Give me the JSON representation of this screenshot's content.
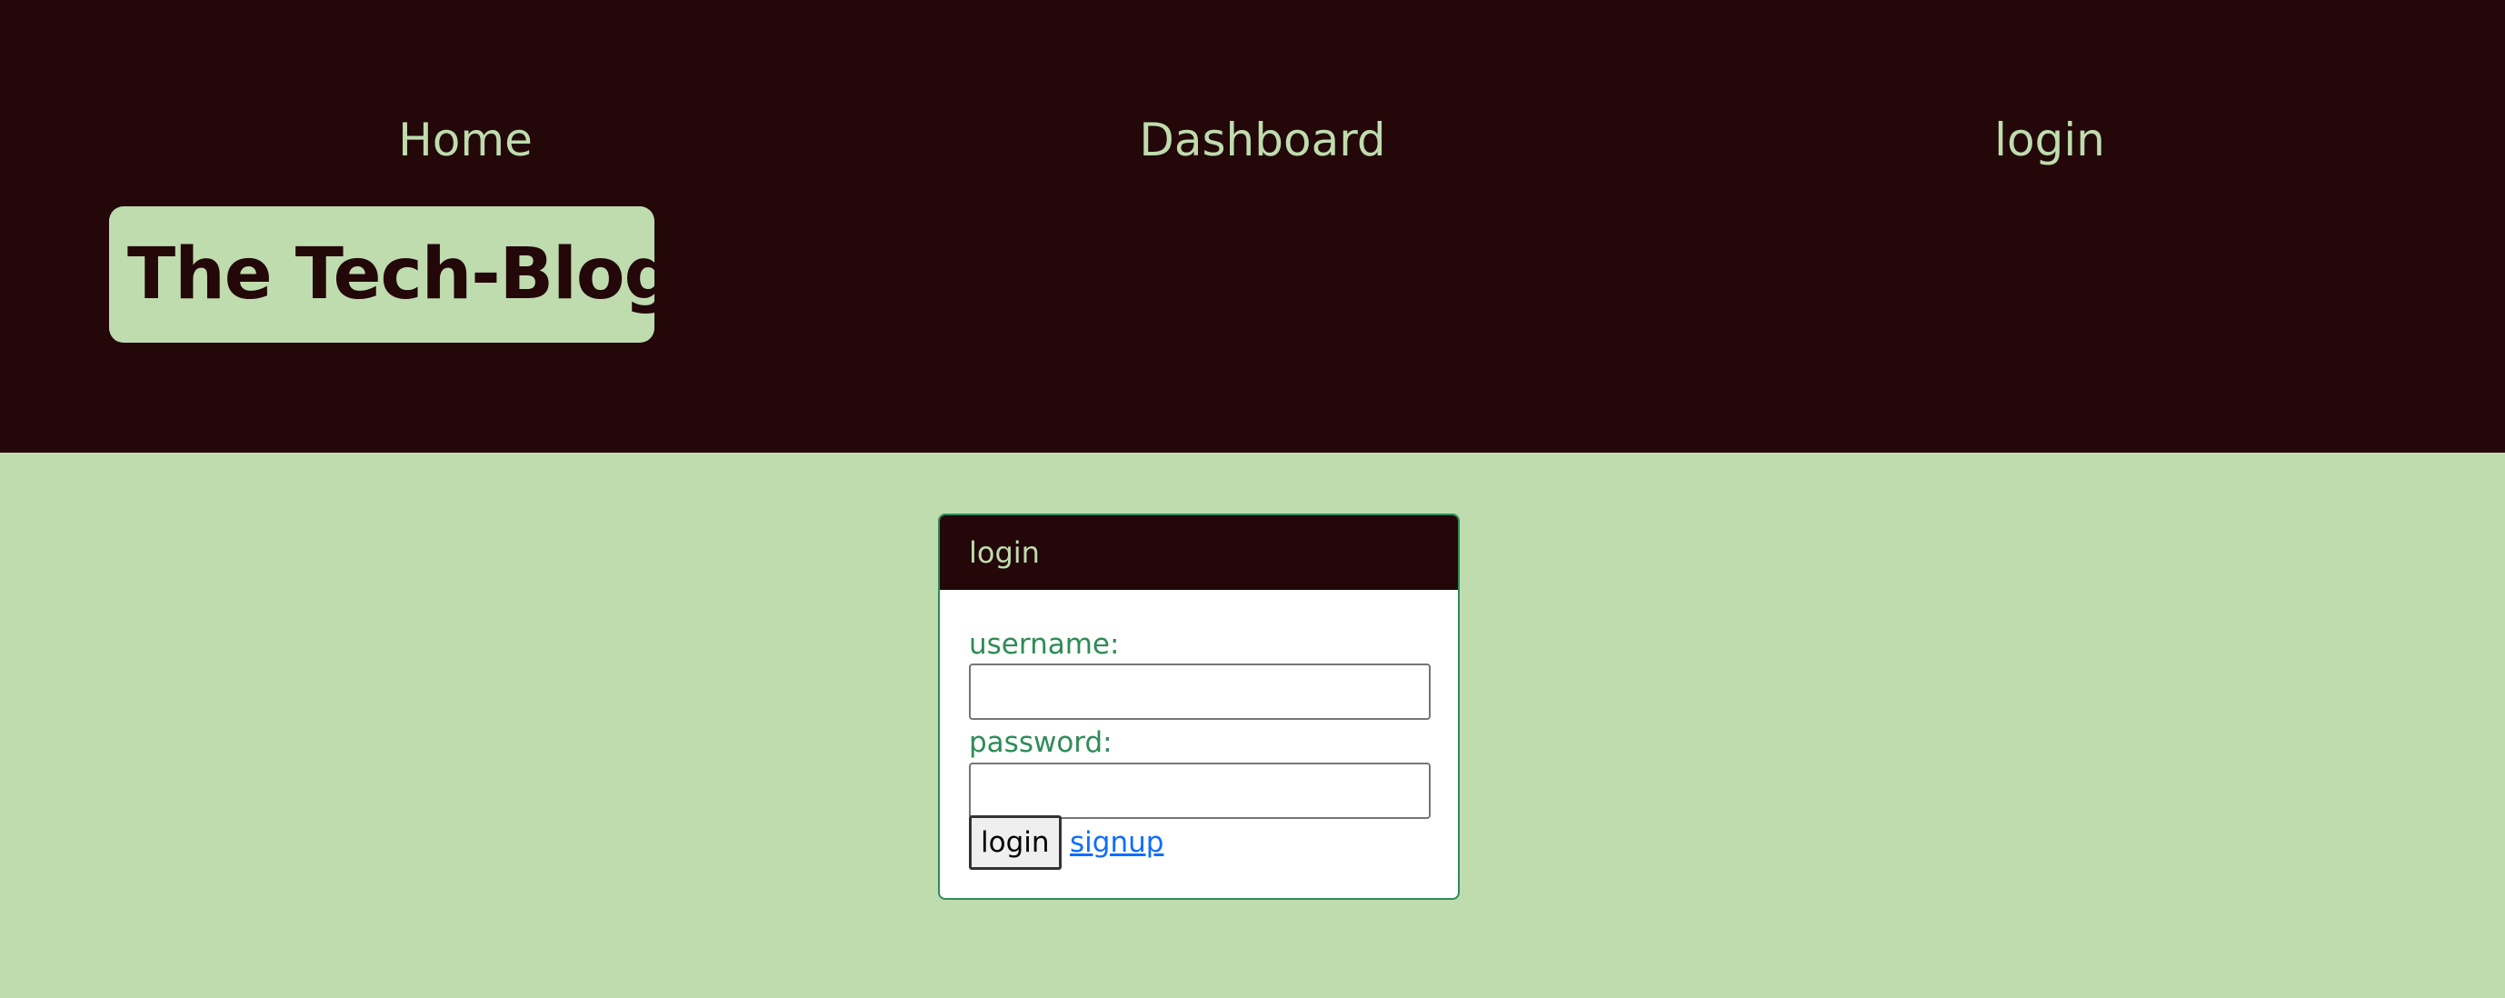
{
  "nav": {
    "home": "Home",
    "dashboard": "Dashboard",
    "login": "login"
  },
  "brand": {
    "title": "The Tech-Blog"
  },
  "login_card": {
    "header": "login",
    "username_label": "username:",
    "username_value": "",
    "password_label": "password:",
    "password_value": "",
    "login_button": "login",
    "signup_link": "signup"
  },
  "colors": {
    "header_bg": "#230709",
    "page_bg": "#bfdcae",
    "label_green": "#2e8b57",
    "link_blue": "#0d6efd"
  }
}
